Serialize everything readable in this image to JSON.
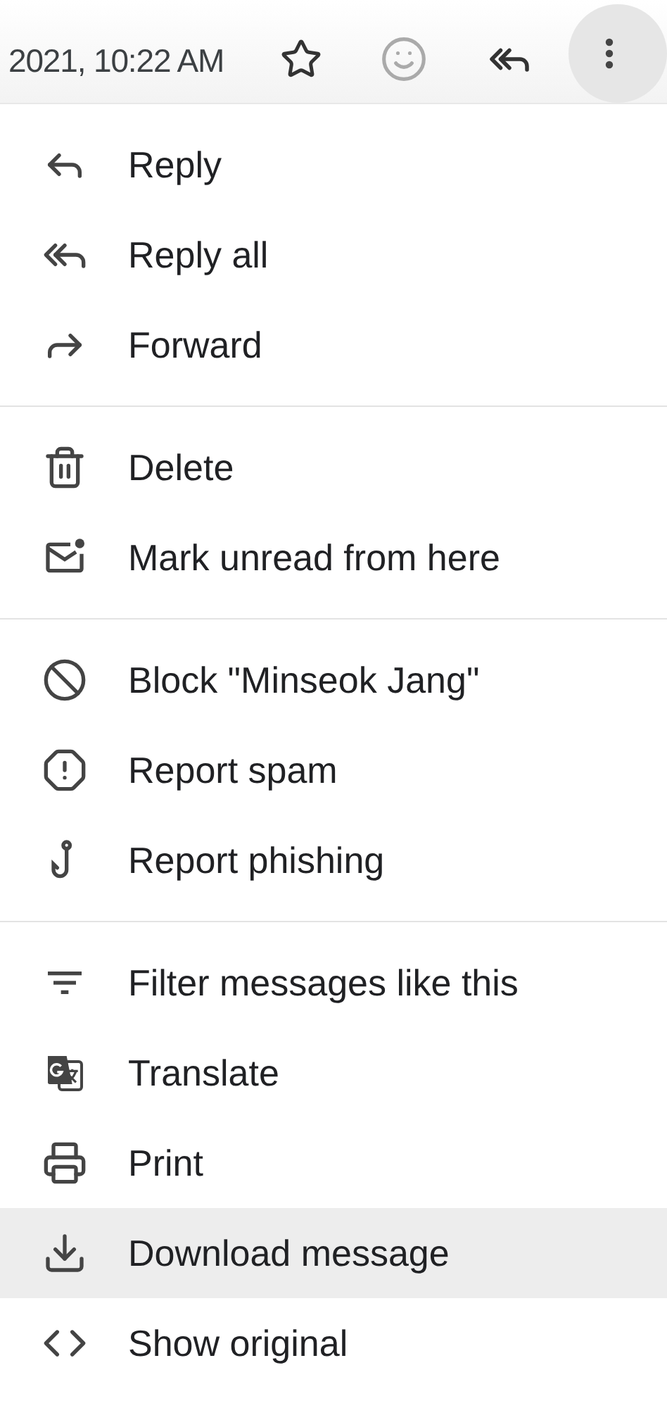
{
  "header": {
    "date": "2021, 10:22 AM"
  },
  "menu": {
    "sections": [
      [
        {
          "kind": "reply",
          "label": "Reply",
          "selected": false
        },
        {
          "kind": "reply-all",
          "label": "Reply all",
          "selected": false
        },
        {
          "kind": "forward",
          "label": "Forward",
          "selected": false
        }
      ],
      [
        {
          "kind": "delete",
          "label": "Delete",
          "selected": false
        },
        {
          "kind": "unread",
          "label": "Mark unread from here",
          "selected": false
        }
      ],
      [
        {
          "kind": "block",
          "label": "Block \"Minseok Jang\"",
          "selected": false
        },
        {
          "kind": "spam",
          "label": "Report spam",
          "selected": false
        },
        {
          "kind": "phishing",
          "label": "Report phishing",
          "selected": false
        }
      ],
      [
        {
          "kind": "filter",
          "label": "Filter messages like this",
          "selected": false
        },
        {
          "kind": "translate",
          "label": "Translate",
          "selected": false
        },
        {
          "kind": "print",
          "label": "Print",
          "selected": false
        },
        {
          "kind": "download",
          "label": "Download message",
          "selected": true
        },
        {
          "kind": "source",
          "label": "Show original",
          "selected": false
        }
      ]
    ]
  }
}
